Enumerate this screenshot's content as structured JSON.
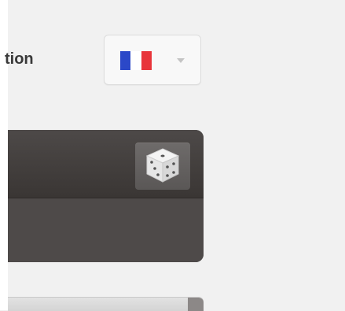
{
  "section": {
    "title": "tion"
  },
  "language_select": {
    "selected_flag": "france-flag",
    "flag_colors": [
      "#2b48c8",
      "#ffffff",
      "#e8343a"
    ],
    "caret_icon": "chevron-down-icon"
  },
  "panel": {
    "random_button_icon": "dice-icon"
  },
  "colors": {
    "page_background": "#f1f1f1",
    "panel_background": "#4a4645",
    "button_background": "#666362"
  }
}
